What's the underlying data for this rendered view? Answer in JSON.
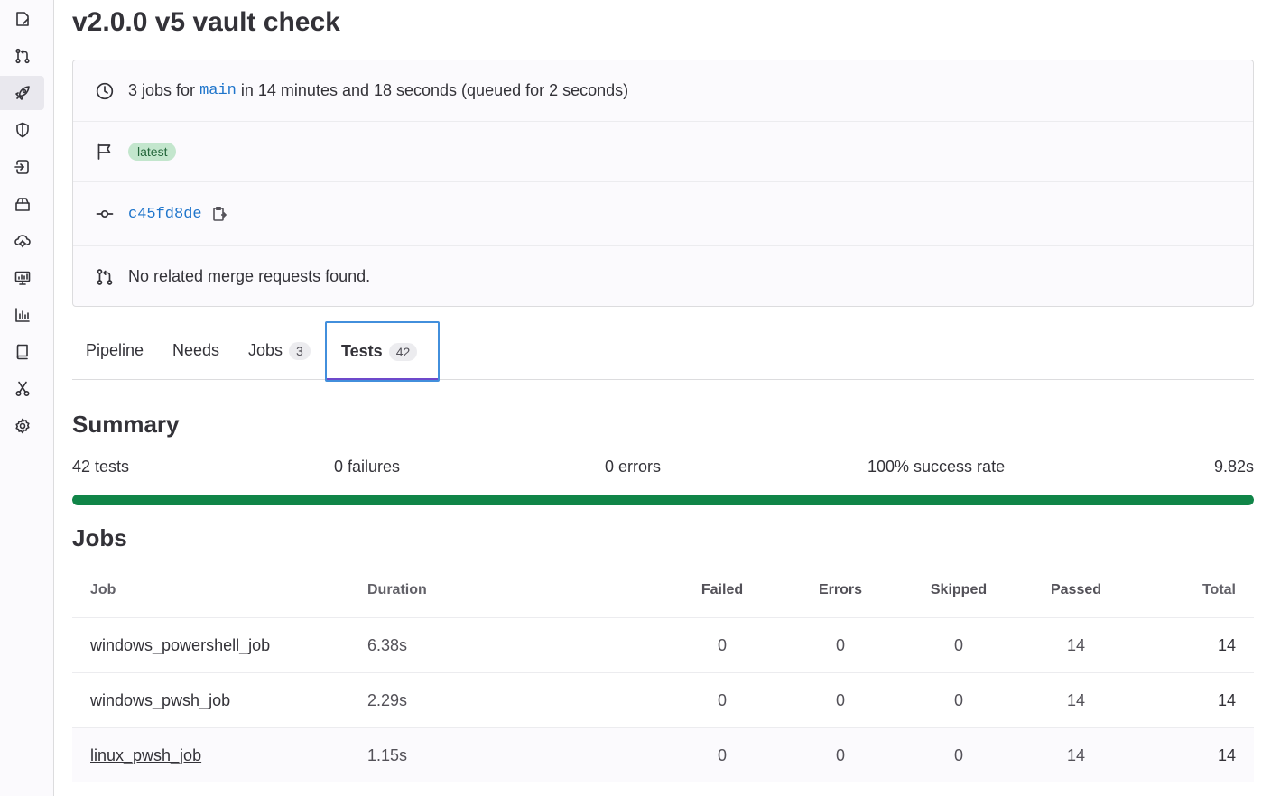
{
  "sidebar": {
    "items": [
      {
        "icon": "issues-icon",
        "active": false
      },
      {
        "icon": "merge-request-icon",
        "active": false
      },
      {
        "icon": "rocket-icon",
        "active": true
      },
      {
        "icon": "shield-icon",
        "active": false
      },
      {
        "icon": "deployments-icon",
        "active": false
      },
      {
        "icon": "package-icon",
        "active": false
      },
      {
        "icon": "cloud-gear-icon",
        "active": false
      },
      {
        "icon": "monitor-icon",
        "active": false
      },
      {
        "icon": "analytics-icon",
        "active": false
      },
      {
        "icon": "book-icon",
        "active": false
      },
      {
        "icon": "snippet-icon",
        "active": false
      },
      {
        "icon": "settings-icon",
        "active": false
      }
    ]
  },
  "page": {
    "title": "v2.0.0 v5 vault check"
  },
  "info": {
    "jobs_prefix": "3 jobs for",
    "branch": "main",
    "jobs_suffix": "in 14 minutes and 18 seconds (queued for 2 seconds)",
    "badge": "latest",
    "commit_sha": "c45fd8de",
    "merge_requests": "No related merge requests found."
  },
  "tabs": [
    {
      "label": "Pipeline",
      "count": null,
      "active": false
    },
    {
      "label": "Needs",
      "count": null,
      "active": false
    },
    {
      "label": "Jobs",
      "count": "3",
      "active": false
    },
    {
      "label": "Tests",
      "count": "42",
      "active": true
    }
  ],
  "summary": {
    "heading": "Summary",
    "tests": "42 tests",
    "failures": "0 failures",
    "errors": "0 errors",
    "success_rate": "100% success rate",
    "duration": "9.82s",
    "success_fraction": 1.0,
    "bar_color": "#108548"
  },
  "jobs": {
    "heading": "Jobs",
    "columns": {
      "job": "Job",
      "duration": "Duration",
      "failed": "Failed",
      "errors": "Errors",
      "skipped": "Skipped",
      "passed": "Passed",
      "total": "Total"
    },
    "rows": [
      {
        "job": "windows_powershell_job",
        "duration": "6.38s",
        "failed": "0",
        "errors": "0",
        "skipped": "0",
        "passed": "14",
        "total": "14"
      },
      {
        "job": "windows_pwsh_job",
        "duration": "2.29s",
        "failed": "0",
        "errors": "0",
        "skipped": "0",
        "passed": "14",
        "total": "14"
      },
      {
        "job": "linux_pwsh_job",
        "duration": "1.15s",
        "failed": "0",
        "errors": "0",
        "skipped": "0",
        "passed": "14",
        "total": "14"
      }
    ]
  }
}
